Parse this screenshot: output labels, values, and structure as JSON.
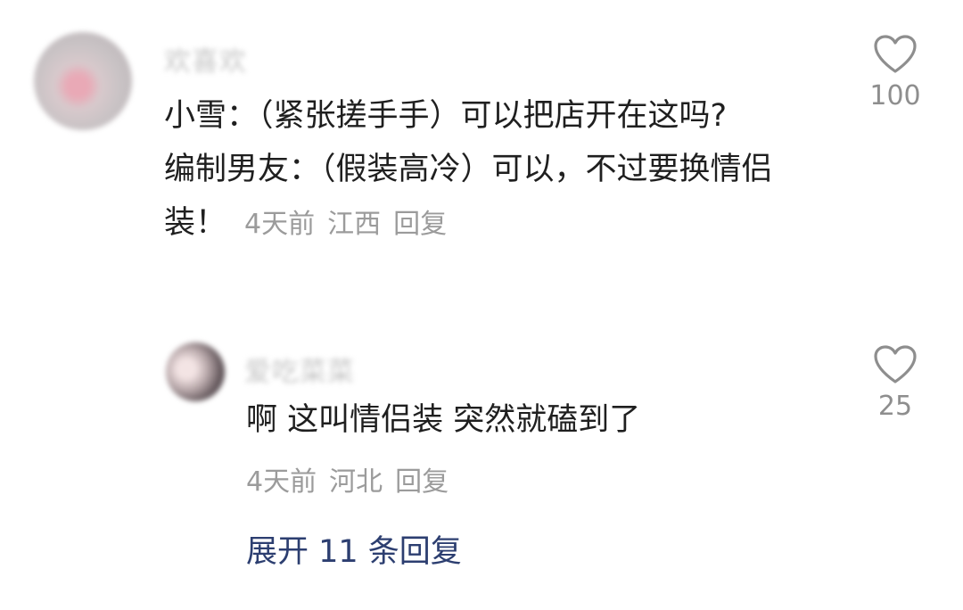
{
  "comment": {
    "username": "欢喜欢",
    "text": "小雪：（紧张搓手手）可以把店开在这吗?\n编制男友：（假装高冷）可以，不过要换情侣装！",
    "time": "4天前",
    "location": "江西",
    "reply_label": "回复",
    "likes": "100"
  },
  "reply": {
    "username": "爱吃菜菜",
    "text": "啊 这叫情侣装 突然就磕到了",
    "time": "4天前",
    "location": "河北",
    "reply_label": "回复",
    "likes": "25"
  },
  "expand": {
    "label": "展开 11 条回复"
  },
  "colors": {
    "text": "#1f1f1f",
    "meta": "#9b9b9b",
    "link": "#2c3e70",
    "icon": "#8e8e8e"
  },
  "icons": {
    "like": "heart-outline-icon"
  }
}
